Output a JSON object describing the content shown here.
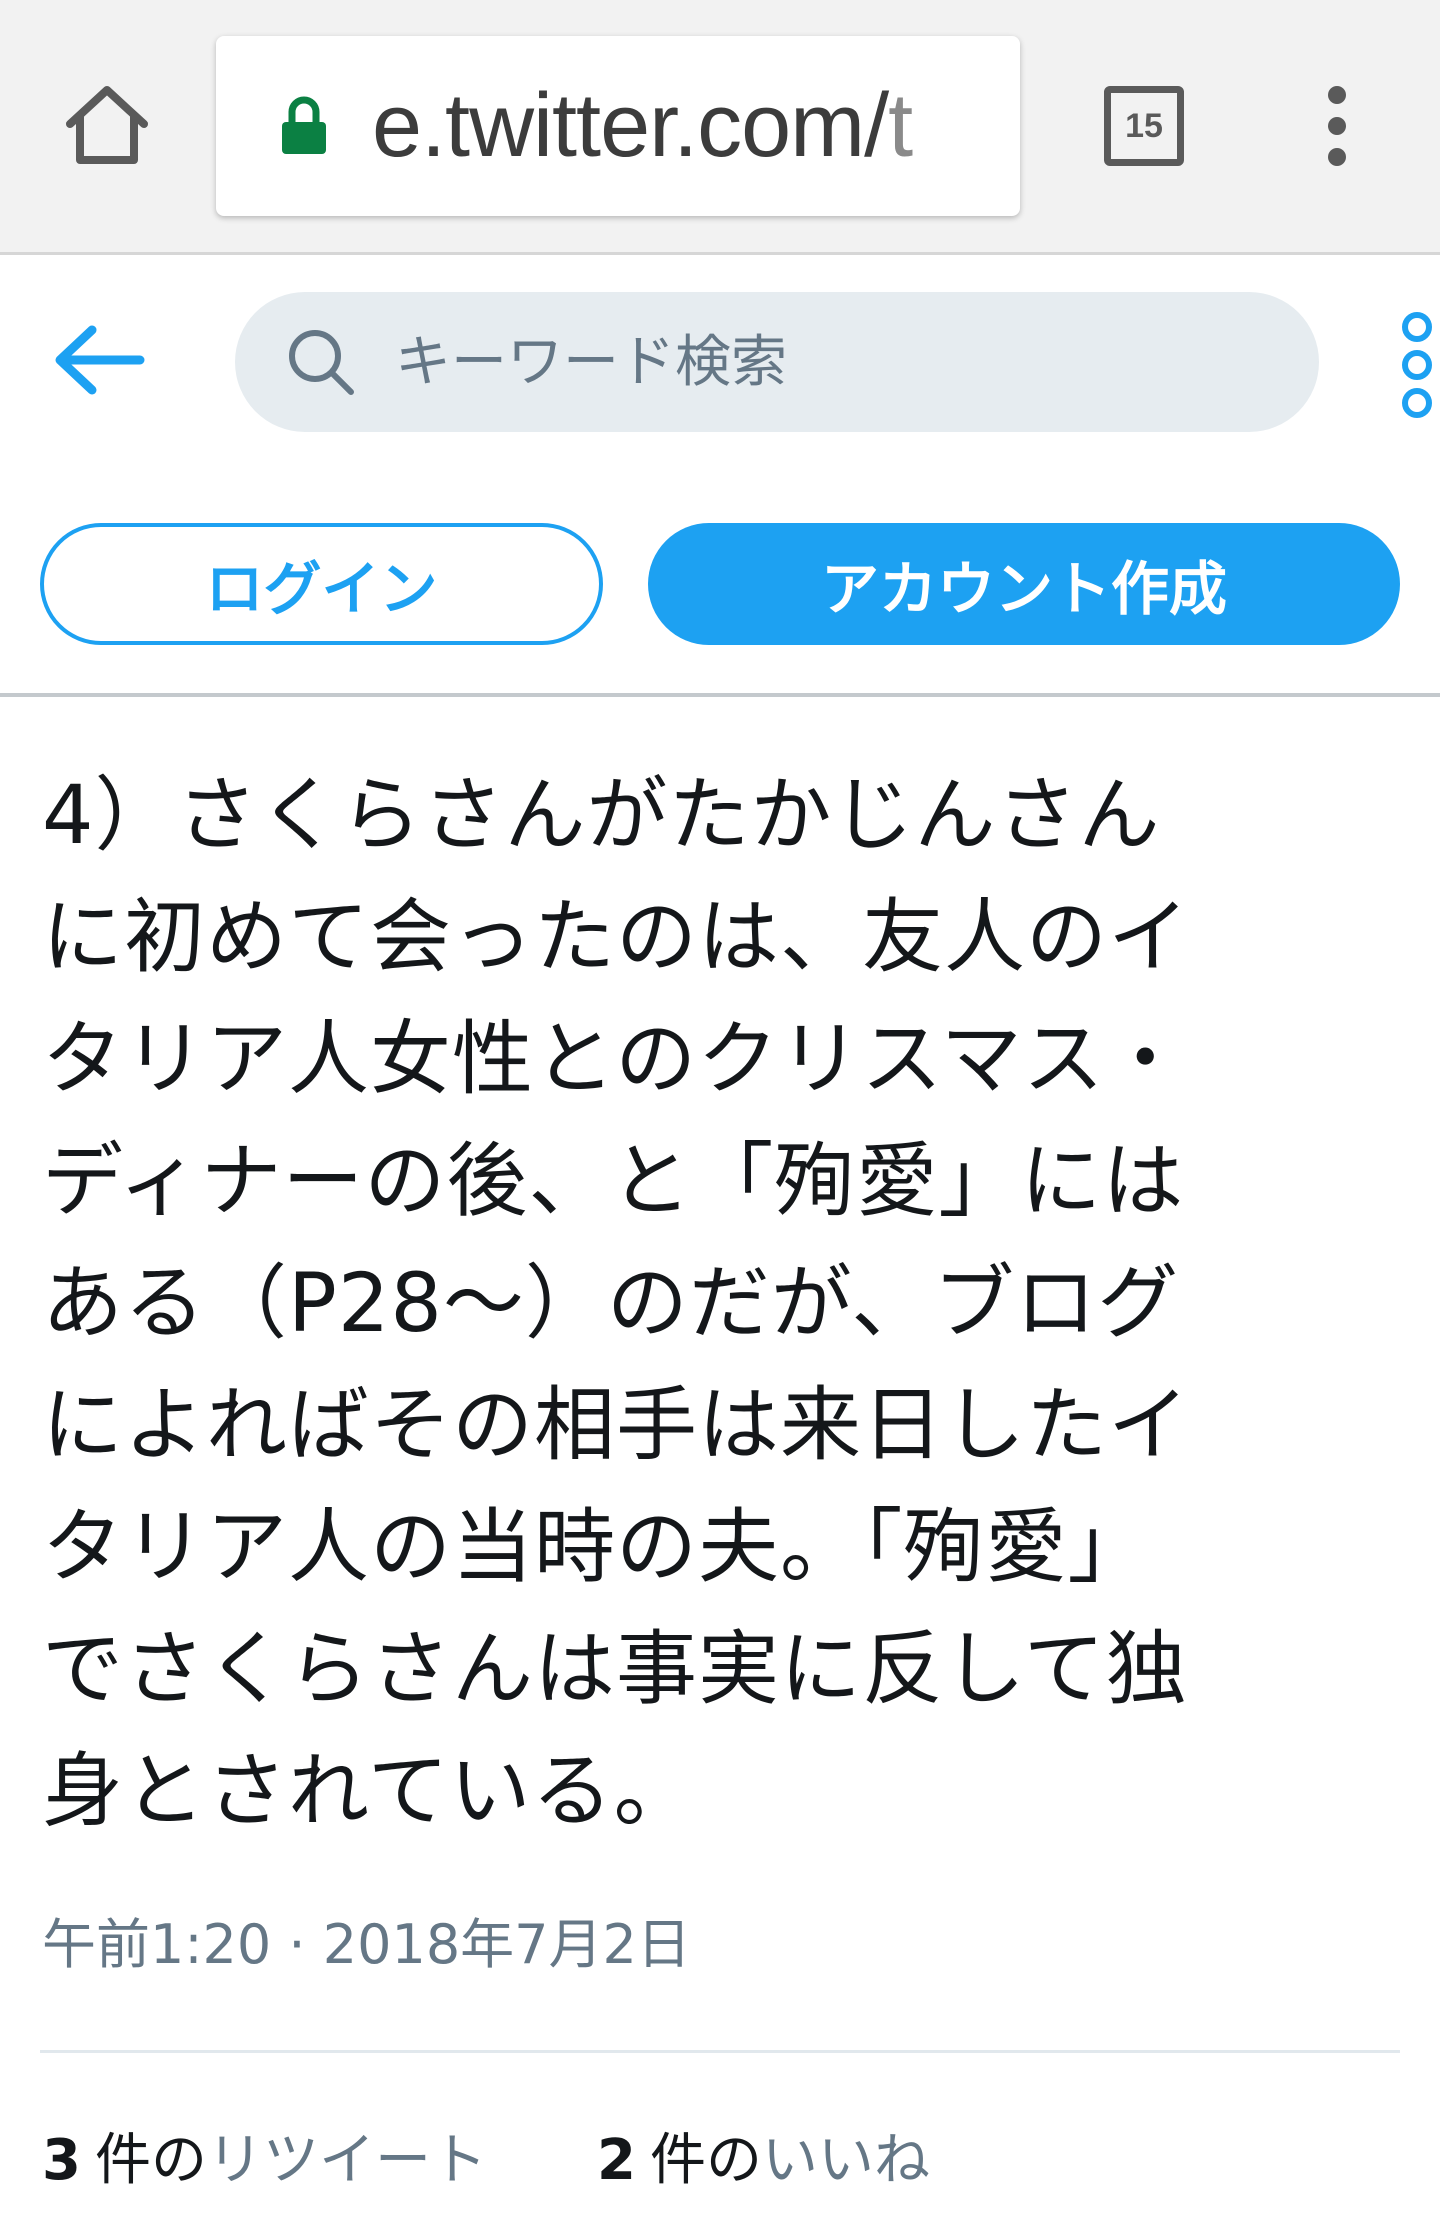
{
  "browser": {
    "url_main": "e.twitter.com/",
    "url_fade": "t",
    "tab_count": "15"
  },
  "header": {
    "search_placeholder": "キーワード検索"
  },
  "auth": {
    "login_label": "ログイン",
    "signup_label": "アカウント作成"
  },
  "tweet": {
    "lines": [
      "4）さくらさんがたかじんさん",
      "に初めて会ったのは、友人のイ",
      "タリア人女性とのクリスマス・",
      "ディナーの後、と「殉愛」には",
      "ある（P28〜）のだが、ブログ",
      "によればその相手は来日したイ",
      "タリア人の当時の夫。「殉愛」",
      "でさくらさんは事実に反して独",
      "身とされている。"
    ],
    "timestamp": "午前1:20 · 2018年7月2日"
  },
  "stats": {
    "retweets": {
      "count": "3",
      "unit": "件の",
      "label": "リツイート"
    },
    "likes": {
      "count": "2",
      "unit": "件の",
      "label": "いいね"
    }
  },
  "colors": {
    "accent": "#1da1f2",
    "muted": "#657786",
    "text": "#14171a"
  }
}
